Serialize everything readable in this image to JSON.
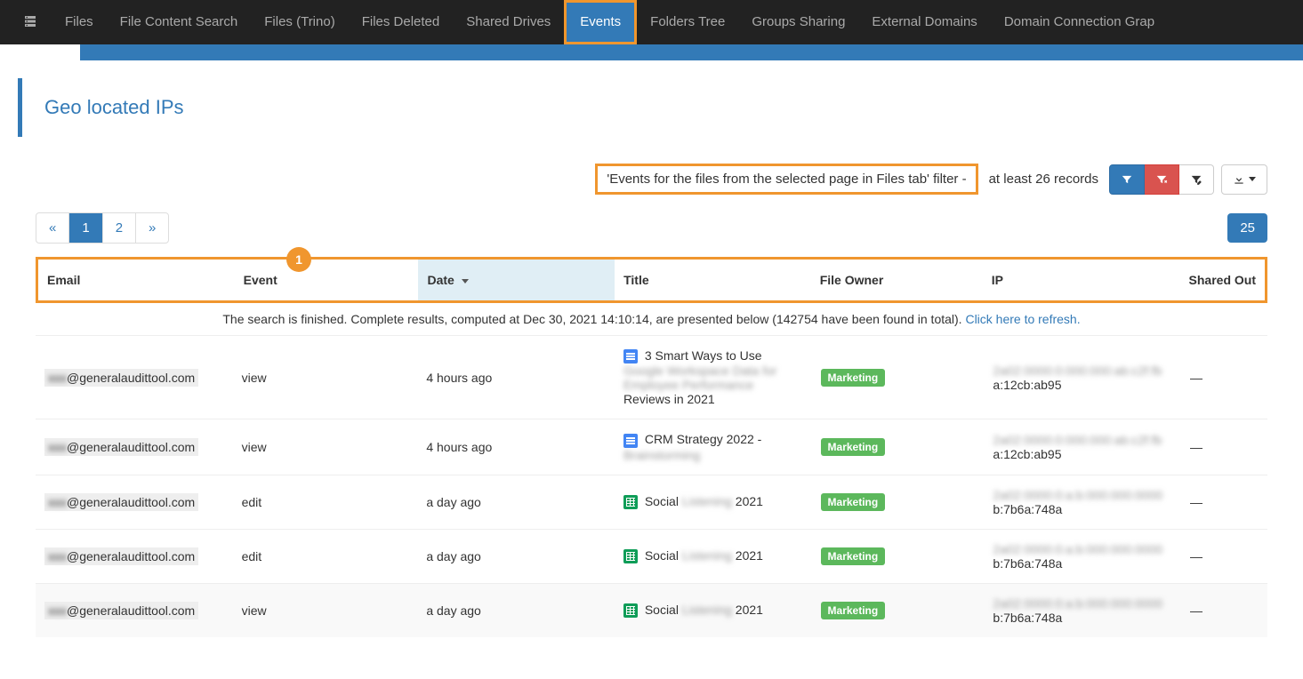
{
  "nav": {
    "items": [
      {
        "label": "Files",
        "active": false
      },
      {
        "label": "File Content Search",
        "active": false
      },
      {
        "label": "Files (Trino)",
        "active": false
      },
      {
        "label": "Files Deleted",
        "active": false
      },
      {
        "label": "Shared Drives",
        "active": false
      },
      {
        "label": "Events",
        "active": true
      },
      {
        "label": "Folders Tree",
        "active": false
      },
      {
        "label": "Groups Sharing",
        "active": false
      },
      {
        "label": "External Domains",
        "active": false
      },
      {
        "label": "Domain Connection Grap",
        "active": false
      }
    ]
  },
  "section": {
    "title": "Geo located IPs"
  },
  "filter": {
    "applied_text": "'Events for the files from the selected page in Files tab' filter -",
    "records_text": "at least 26 records"
  },
  "pagination": {
    "prev": "«",
    "pages": [
      "1",
      "2"
    ],
    "next": "»",
    "page_size": "25"
  },
  "annotation": {
    "badge": "1"
  },
  "table": {
    "headers": {
      "email": "Email",
      "event": "Event",
      "date": "Date",
      "title": "Title",
      "owner": "File Owner",
      "ip": "IP",
      "shared_out": "Shared Out"
    },
    "summary_prefix": "The search is finished. Complete results, computed at Dec 30, 2021 14:10:14, are presented below (142754 have been found in total). ",
    "summary_link": "Click here to refresh.",
    "rows": [
      {
        "email_blur": "xxx",
        "email_domain": "@generalaudittool.com",
        "event": "view",
        "date": "4 hours ago",
        "icon": "doc",
        "title_line1": "3 Smart Ways to Use",
        "title_blur1": "Google Workspace Data for",
        "title_blur2": "Employee Performance",
        "title_line4": "Reviews in 2021",
        "owner_badge": "Marketing",
        "ip_blur": "2a02:0000:0:000:000:ab:c2f:fb",
        "ip_tail": "a:12cb:ab95",
        "shared_out": "—"
      },
      {
        "email_blur": "xxx",
        "email_domain": "@generalaudittool.com",
        "event": "view",
        "date": "4 hours ago",
        "icon": "doc",
        "title_line1": "CRM Strategy 2022 -",
        "title_blur1": "Brainstorming",
        "title_blur2": "",
        "title_line4": "",
        "owner_badge": "Marketing",
        "ip_blur": "2a02:0000:0:000:000:ab:c2f:fb",
        "ip_tail": "a:12cb:ab95",
        "shared_out": "—"
      },
      {
        "email_blur": "xxx",
        "email_domain": "@generalaudittool.com",
        "event": "edit",
        "date": "a day ago",
        "icon": "sheet",
        "title_line1": "Social",
        "title_blur1": "Listening",
        "title_blur2": "",
        "title_line4": "2021",
        "owner_badge": "Marketing",
        "ip_blur": "2a02:0000:0:a:b:000:000:0000",
        "ip_tail": "b:7b6a:748a",
        "shared_out": "—"
      },
      {
        "email_blur": "xxx",
        "email_domain": "@generalaudittool.com",
        "event": "edit",
        "date": "a day ago",
        "icon": "sheet",
        "title_line1": "Social",
        "title_blur1": "Listening",
        "title_blur2": "",
        "title_line4": "2021",
        "owner_badge": "Marketing",
        "ip_blur": "2a02:0000:0:a:b:000:000:0000",
        "ip_tail": "b:7b6a:748a",
        "shared_out": "—"
      },
      {
        "email_blur": "xxx",
        "email_domain": "@generalaudittool.com",
        "event": "view",
        "date": "a day ago",
        "icon": "sheet",
        "title_line1": "Social",
        "title_blur1": "Listening",
        "title_blur2": "",
        "title_line4": "2021",
        "owner_badge": "Marketing",
        "ip_blur": "2a02:0000:0:a:b:000:000:0000",
        "ip_tail": "b:7b6a:748a",
        "shared_out": "—"
      }
    ]
  }
}
